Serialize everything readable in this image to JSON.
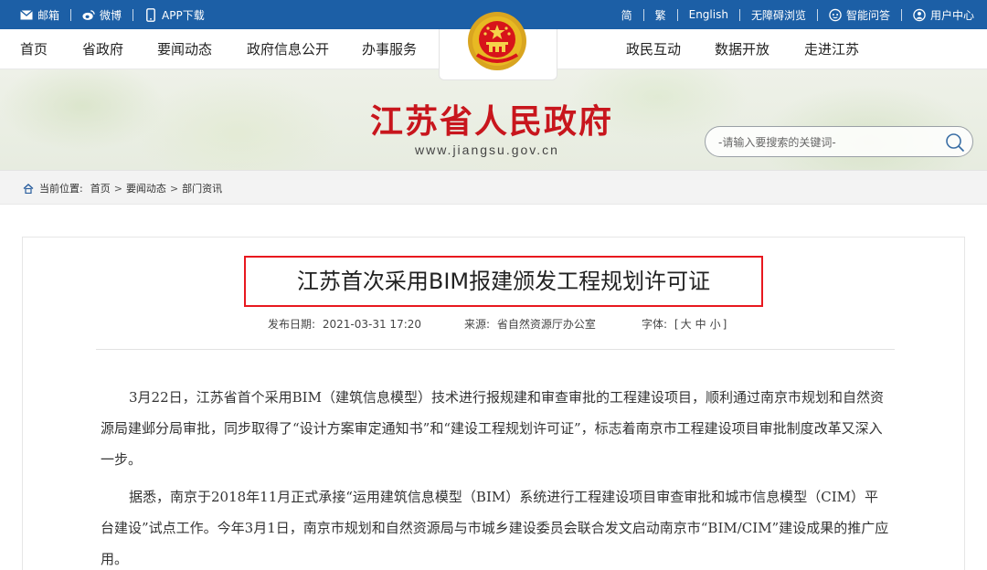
{
  "topbar": {
    "left": [
      {
        "icon": "mail-icon",
        "label": "邮箱"
      },
      {
        "icon": "weibo-icon",
        "label": "微博"
      },
      {
        "icon": "phone-icon",
        "label": "APP下载"
      }
    ],
    "right": {
      "simplified": "简",
      "traditional": "繁",
      "english": "English",
      "accessibility": "无障碍浏览",
      "qa_icon": "robot-icon",
      "qa": "智能问答",
      "user_icon": "user-icon",
      "user_center": "用户中心"
    },
    "bg_color": "#1c5fa6"
  },
  "nav": {
    "items": [
      "首页",
      "省政府",
      "要闻动态",
      "政府信息公开",
      "办事服务",
      "政民互动",
      "数据开放",
      "走进江苏"
    ],
    "emblem_icon": "national-emblem-icon"
  },
  "banner": {
    "title": "江苏省人民政府",
    "url": "www.jiangsu.gov.cn",
    "title_color": "#c8161d",
    "search_placeholder": "-请输入要搜索的关键词-",
    "search_icon": "search-icon"
  },
  "breadcrumb": {
    "home_icon": "home-icon",
    "label": "当前位置:",
    "items": [
      "首页",
      "要闻动态",
      "部门资讯"
    ],
    "separator": ">"
  },
  "article": {
    "title": "江苏首次采用BIM报建颁发工程规划许可证",
    "date_label": "发布日期:",
    "date": "2021-03-31 17:20",
    "source_label": "来源:",
    "source": "省自然资源厅办公室",
    "font_label": "字体:",
    "font_open": "[",
    "font_large": "大",
    "font_medium": "中",
    "font_small": "小",
    "font_close": "]",
    "highlight_color": "#e8181f",
    "paragraphs": [
      "3月22日，江苏省首个采用BIM（建筑信息模型）技术进行报规建和审查审批的工程建设项目，顺利通过南京市规划和自然资源局建邺分局审批，同步取得了“设计方案审定通知书”和“建设工程规划许可证”，标志着南京市工程建设项目审批制度改革又深入一步。",
      "据悉，南京于2018年11月正式承接“运用建筑信息模型（BIM）系统进行工程建设项目审查审批和城市信息模型（CIM）平台建设”试点工作。今年3月1日，南京市规划和自然资源局与市城乡建设委员会联合发文启动南京市“BIM/CIM”建设成果的推广应用。"
    ]
  }
}
